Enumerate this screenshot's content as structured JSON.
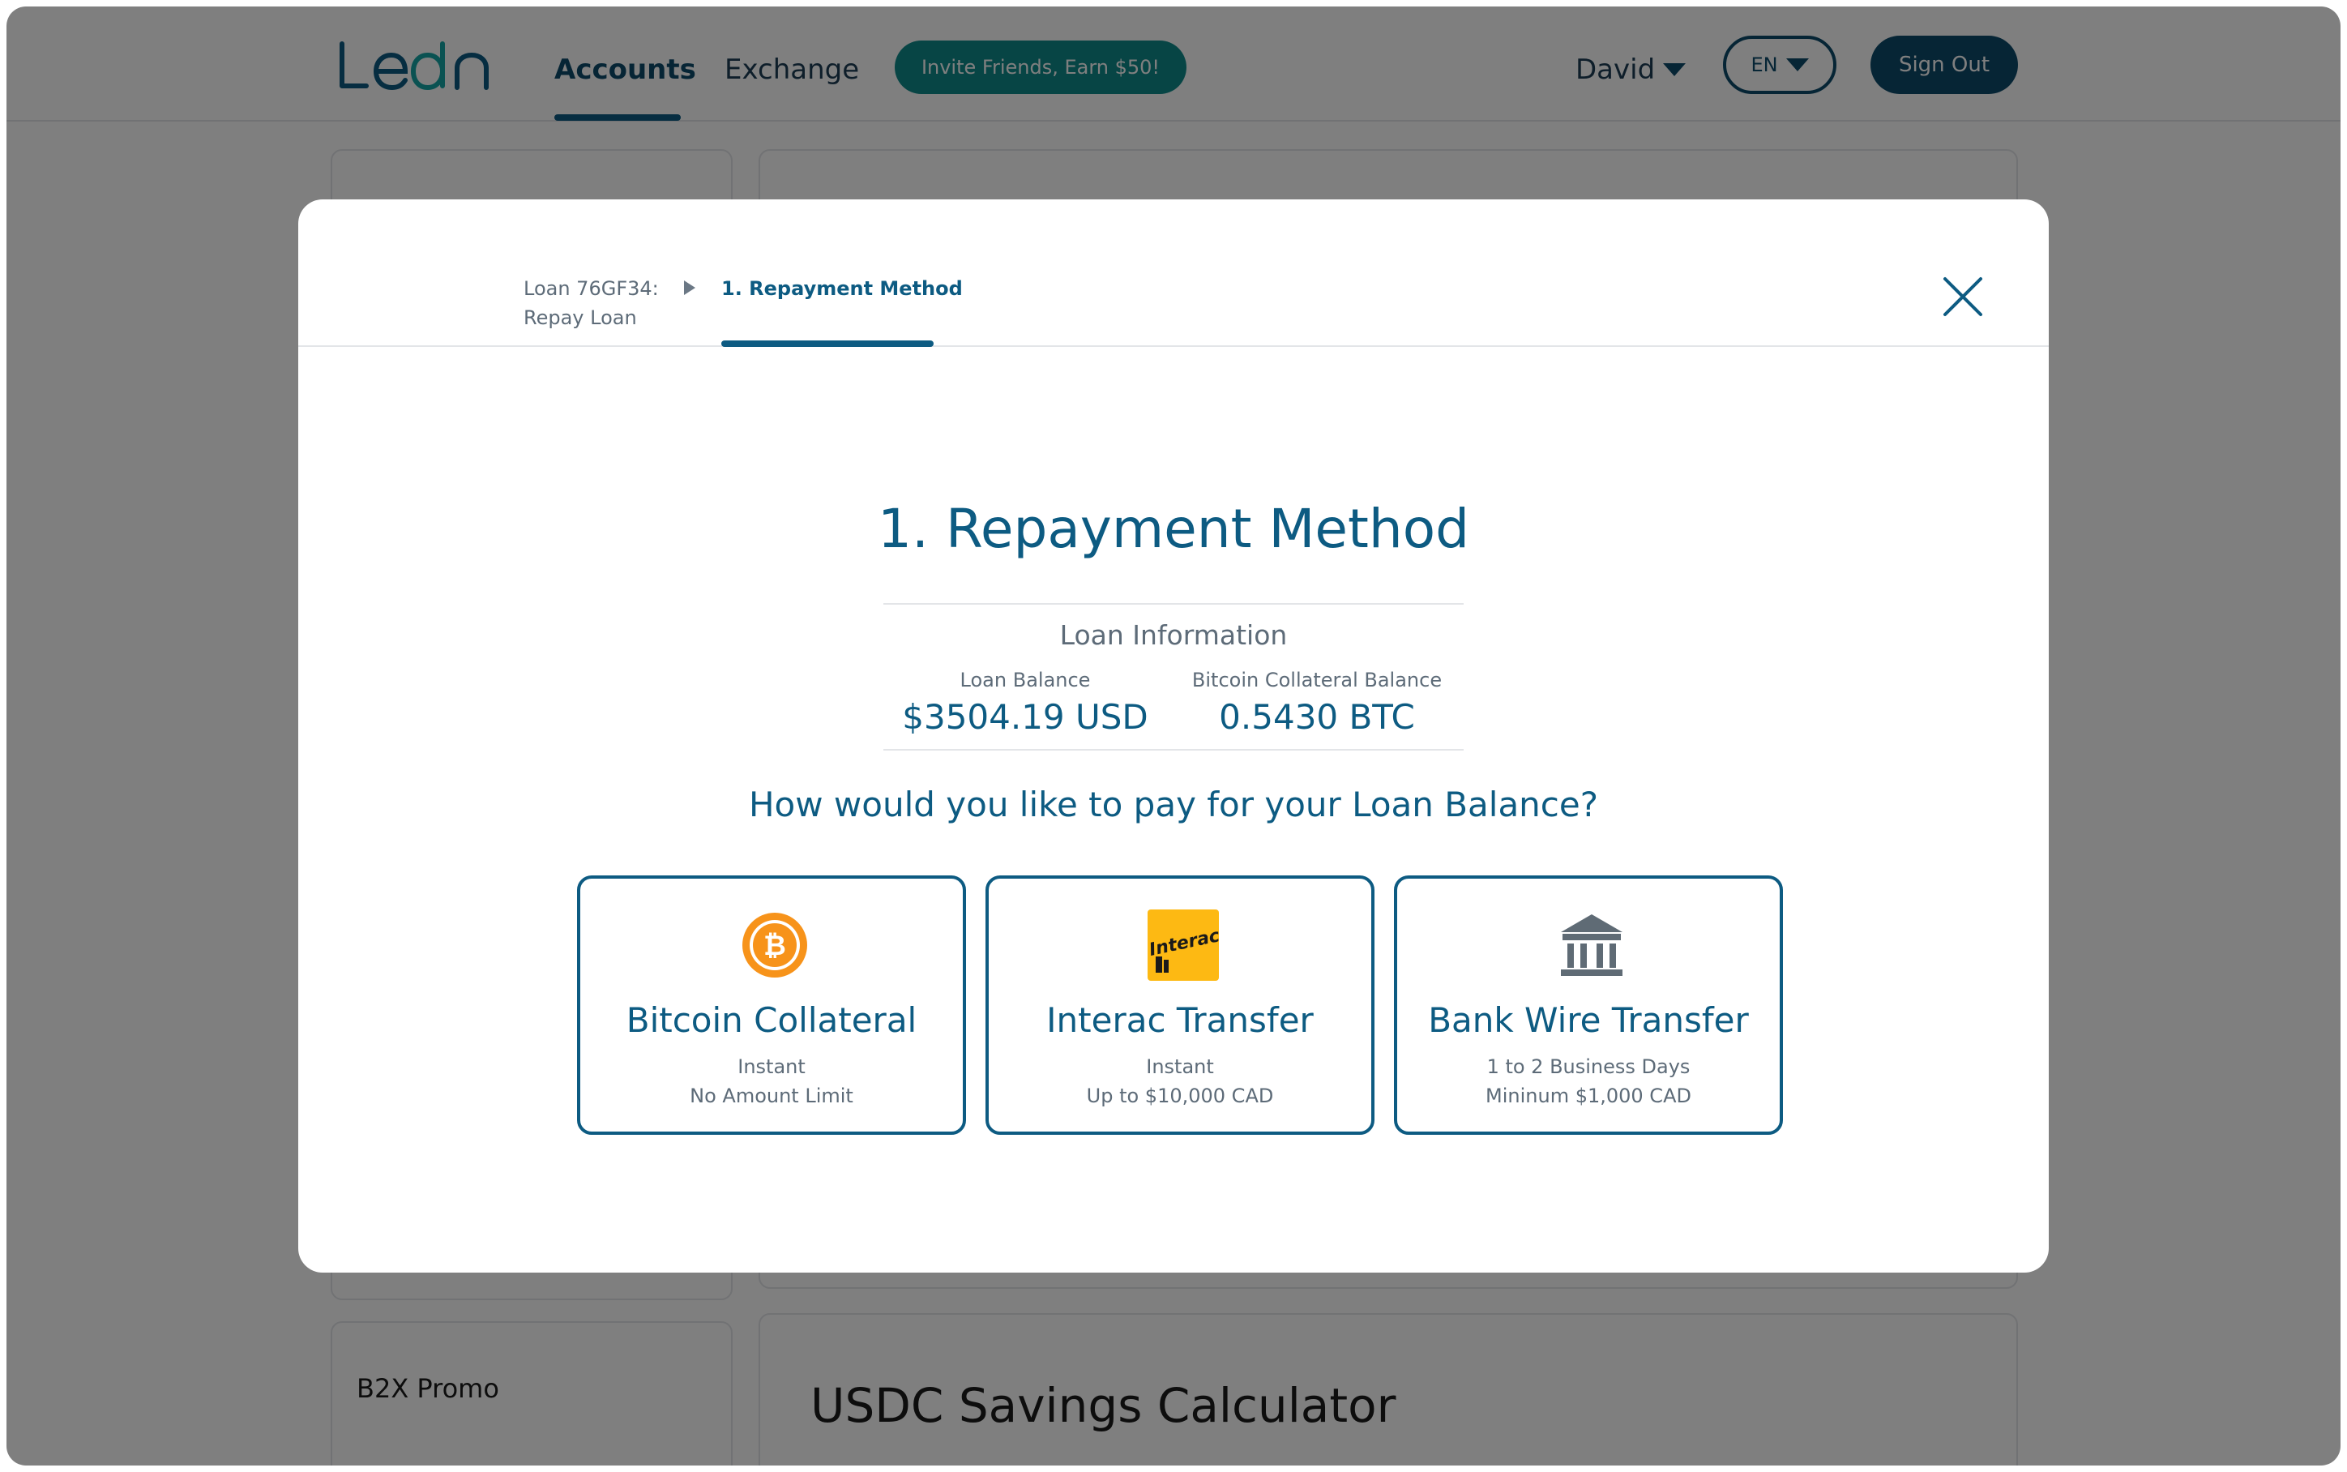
{
  "nav": {
    "logo_text": "Ledn",
    "accounts": "Accounts",
    "exchange": "Exchange",
    "invite": "Invite Friends, Earn $50!",
    "user": "David",
    "language": "EN",
    "sign_out": "Sign Out"
  },
  "background": {
    "promo_title": "B2X Promo",
    "calculator_title": "USDC Savings Calculator"
  },
  "modal": {
    "breadcrumb_loan": "Loan 76GF34:",
    "breadcrumb_action": "Repay Loan",
    "breadcrumb_step": "1. Repayment Method",
    "title": "1. Repayment Method",
    "info_heading": "Loan Information",
    "loan_balance_label": "Loan Balance",
    "loan_balance_value": "$3504.19 USD",
    "collateral_label": "Bitcoin Collateral Balance",
    "collateral_value": "0.5430 BTC",
    "question": "How would you like to pay for your Loan Balance?",
    "options": [
      {
        "icon": "bitcoin-icon",
        "title": "Bitcoin Collateral",
        "line1": "Instant",
        "line2": "No Amount Limit"
      },
      {
        "icon": "interac-icon",
        "title": "Interac Transfer",
        "line1": "Instant",
        "line2": "Up to $10,000 CAD"
      },
      {
        "icon": "bank-icon",
        "title": "Bank Wire Transfer",
        "line1": "1 to 2 Business Days",
        "line2": "Mininum $1,000 CAD"
      }
    ]
  },
  "colors": {
    "primary": "#0d5b82",
    "teal": "#0e8a8a",
    "bitcoin_orange": "#f7931a",
    "interac_yellow": "#fdb913",
    "muted_text": "#5d6b78"
  }
}
